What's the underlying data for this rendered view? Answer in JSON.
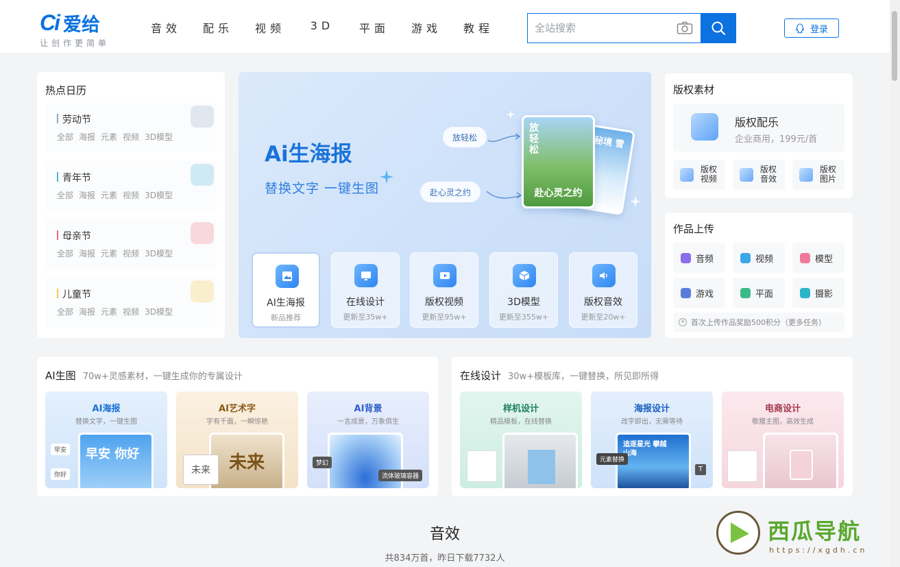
{
  "header": {
    "logo_mark": "Ci",
    "logo_name": "爱给",
    "logo_slogan": "让创作更简单",
    "nav": [
      "音效",
      "配乐",
      "视频",
      "3D",
      "平面",
      "游戏",
      "教程"
    ],
    "search_placeholder": "全站搜索",
    "login": "登录",
    "accent": "#0b72e0"
  },
  "hot": {
    "title": "热点日历",
    "items": [
      {
        "name": "劳动节",
        "color": "#8fa6c8",
        "tags": [
          "全部",
          "海报",
          "元素",
          "视频",
          "3D模型"
        ]
      },
      {
        "name": "青年节",
        "color": "#4fb2d9",
        "tags": [
          "全部",
          "海报",
          "元素",
          "视频",
          "3D模型"
        ]
      },
      {
        "name": "母亲节",
        "color": "#f06b7a",
        "tags": [
          "全部",
          "海报",
          "元素",
          "视频",
          "3D模型"
        ]
      },
      {
        "name": "儿童节",
        "color": "#f5c93a",
        "tags": [
          "全部",
          "海报",
          "元素",
          "视频",
          "3D模型"
        ]
      }
    ]
  },
  "banner": {
    "title": "Ai生海报",
    "subtitle": "替换文字 一键生图",
    "bubble1": "放轻松",
    "bubble2": "赴心灵之约",
    "card1_top": "放轻松",
    "card1_bottom": "赴心灵之约",
    "card2_text": "冰封秘境 雪寻欢",
    "features": [
      {
        "name": "AI生海报",
        "sub": "新品推荐"
      },
      {
        "name": "在线设计",
        "sub": "更新至35w+"
      },
      {
        "name": "版权视频",
        "sub": "更新至95w+"
      },
      {
        "name": "3D模型",
        "sub": "更新至355w+"
      },
      {
        "name": "版权音效",
        "sub": "更新至20w+"
      }
    ]
  },
  "copyright": {
    "title": "版权素材",
    "main_title": "版权配乐",
    "main_sub": "企业商用，199元/首",
    "items": [
      "版权视频",
      "版权音效",
      "版权图片"
    ]
  },
  "upload": {
    "title": "作品上传",
    "items": [
      {
        "label": "音频",
        "color": "#8a6de9"
      },
      {
        "label": "视频",
        "color": "#3aa7e8"
      },
      {
        "label": "模型",
        "color": "#f07a9a"
      },
      {
        "label": "游戏",
        "color": "#5b7bdc"
      },
      {
        "label": "平面",
        "color": "#3dba8a"
      },
      {
        "label": "摄影",
        "color": "#2cb5c9"
      }
    ],
    "tip": "首次上传作品奖励500积分（更多任务）"
  },
  "ai_section": {
    "title": "AI生图",
    "sub": "70w+灵感素材，一键生成你的专属设计",
    "tiles": [
      {
        "title": "AI海报",
        "sub": "替换文字，一键生图",
        "mini1": "早安",
        "mini2": "你好",
        "img_text": "早安 你好",
        "bg": "#e4f0fd",
        "tc": "#1a6fd2"
      },
      {
        "title": "AI艺术字",
        "sub": "字有千面，一瞬惊艳",
        "mini1": "未来",
        "mini2": "",
        "img_text": "未来",
        "bg": "#fbf1e2",
        "tc": "#8a5a1a"
      },
      {
        "title": "AI背景",
        "sub": "一言成景，万象俱生",
        "mini1": "梦幻",
        "mini2": "流体玻璃容器",
        "img_text": "",
        "bg": "#e8eefc",
        "tc": "#2e5fc9"
      }
    ]
  },
  "online_section": {
    "title": "在线设计",
    "sub": "30w+模板库，一键替换，所见即所得",
    "tiles": [
      {
        "title": "样机设计",
        "sub": "精品模板，在线替换",
        "mini1": "",
        "mini2": "",
        "img_text": "",
        "bg": "#e2f5ef",
        "tc": "#1b7d5a"
      },
      {
        "title": "海报设计",
        "sub": "改字即出，无需等待",
        "mini1": "元素替换",
        "mini2": "",
        "img_text": "追逐星光 攀越山海",
        "bg": "#e3effc",
        "tc": "#1a5fbf"
      },
      {
        "title": "电商设计",
        "sub": "敬赠主图，高效生成",
        "mini1": "",
        "mini2": "",
        "img_text": "",
        "bg": "#fbe9ee",
        "tc": "#a3384f"
      }
    ]
  },
  "sound": {
    "title": "音效",
    "sub": "共834万首，昨日下载7732人"
  },
  "watermark": {
    "name": "西瓜导航",
    "url": "https://xgdh.cn"
  }
}
